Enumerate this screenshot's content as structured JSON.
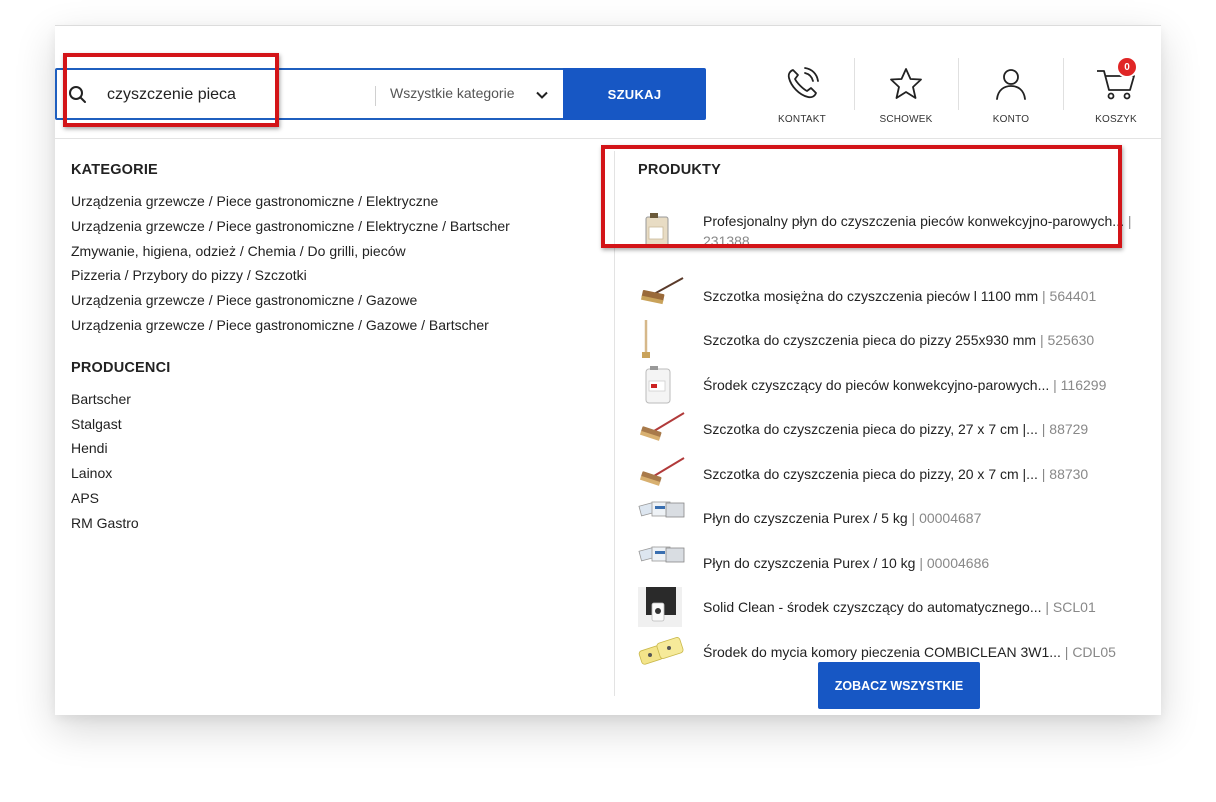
{
  "search": {
    "query": "czyszczenie pieca",
    "category": "Wszystkie kategorie",
    "button_label": "SZUKAJ"
  },
  "header": {
    "contact_label": "KONTAKT",
    "wishlist_label": "SCHOWEK",
    "account_label": "KONTO",
    "cart_label": "KOSZYK",
    "cart_count": "0"
  },
  "categories": {
    "title": "KATEGORIE",
    "items": [
      "Urządzenia grzewcze / Piece gastronomiczne / Elektryczne",
      "Urządzenia grzewcze / Piece gastronomiczne / Elektryczne / Bartscher",
      "Zmywanie, higiena, odzież / Chemia / Do grilli, pieców",
      "Pizzeria / Przybory do pizzy / Szczotki",
      "Urządzenia grzewcze / Piece gastronomiczne / Gazowe",
      "Urządzenia grzewcze / Piece gastronomiczne / Gazowe / Bartscher"
    ]
  },
  "producers": {
    "title": "PRODUCENCI",
    "items": [
      "Bartscher",
      "Stalgast",
      "Hendi",
      "Lainox",
      "APS",
      "RM Gastro"
    ]
  },
  "products": {
    "title": "PRODUKTY",
    "items": [
      {
        "name": "Profesjonalny płyn do czyszczenia pieców konwekcyjno-parowych...",
        "code": "| 231388",
        "thumb": "canister-icon"
      },
      {
        "name": "Szczotka mosiężna do czyszczenia pieców l 1100 mm",
        "code": "| 564401",
        "thumb": "brush-icon"
      },
      {
        "name": "Szczotka do czyszczenia pieca do pizzy 255x930 mm",
        "code": "| 525630",
        "thumb": "long-brush-icon"
      },
      {
        "name": "Środek czyszczący do pieców konwekcyjno-parowych...",
        "code": "| 116299",
        "thumb": "canister-icon"
      },
      {
        "name": "Szczotka do czyszczenia pieca do pizzy, 27 x 7 cm |...",
        "code": "| 88729",
        "thumb": "brush-icon"
      },
      {
        "name": "Szczotka do czyszczenia pieca do pizzy, 20 x 7 cm |...",
        "code": "| 88730",
        "thumb": "brush-icon"
      },
      {
        "name": "Płyn do czyszczenia Purex / 5 kg",
        "code": "| 00004687",
        "thumb": "tablets-icon"
      },
      {
        "name": "Płyn do czyszczenia Purex / 10 kg",
        "code": "| 00004686",
        "thumb": "tablets-icon"
      },
      {
        "name": "Solid Clean - środek czyszczący do automatycznego...",
        "code": "| SCL01",
        "thumb": "dispenser-icon"
      },
      {
        "name": "Środek do mycia komory pieczenia COMBICLEAN 3W1...",
        "code": "| CDL05",
        "thumb": "pouches-icon"
      }
    ],
    "see_all_label": "ZOBACZ WSZYSTKIE"
  },
  "colors": {
    "accent": "#1757c4",
    "badge": "#e02626",
    "highlight": "#d31418"
  }
}
